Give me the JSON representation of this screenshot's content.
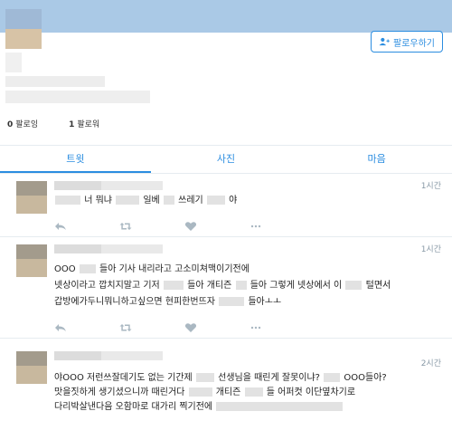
{
  "profile": {
    "follow_button_label": "팔로우하기",
    "following_count": "0",
    "following_label": "팔로잉",
    "followers_count": "1",
    "followers_label": "팔로워"
  },
  "tabs": [
    {
      "label": "트윗"
    },
    {
      "label": "사진"
    },
    {
      "label": "마음"
    }
  ],
  "tweets": [
    {
      "time": "1시간",
      "lines": [
        {
          "parts": [
            "너 뭐냐",
            "일베",
            "쓰레기",
            "야"
          ]
        }
      ]
    },
    {
      "time": "1시간",
      "lines": [
        {
          "parts": [
            "OOO",
            "들아 기사 내리라고 고소미쳐맥이기전에"
          ]
        },
        {
          "parts": [
            "넷상이라고 깝치지말고 기저",
            "들아 개티즌",
            "들아 그렇게 넷상에서 이",
            "털면서"
          ]
        },
        {
          "parts": [
            "갑방에가두니뭐니하고싶으면 현피한번뜨자",
            "들아ㅗㅗ"
          ]
        }
      ]
    },
    {
      "time": "2시간",
      "lines": [
        {
          "parts": [
            "야OOO 저런쓰잘데기도 없는 기간제",
            "선생님을 때린게 잘못이냐?",
            "OOO들아?"
          ]
        },
        {
          "parts": [
            "맛을짓하게 생기셨으니까 때린거다",
            "개티즌",
            "들 어퍼컷 이단옆차기로"
          ]
        },
        {
          "parts": [
            "다리박살낸다음 오함마로 대가리 찍기전에"
          ]
        }
      ]
    }
  ],
  "icons": {
    "reply": "reply-icon",
    "retweet": "retweet-icon",
    "like": "heart-icon",
    "more": "more-icon"
  },
  "colors": {
    "accent": "#2b8de0",
    "muted": "#8899a6"
  }
}
